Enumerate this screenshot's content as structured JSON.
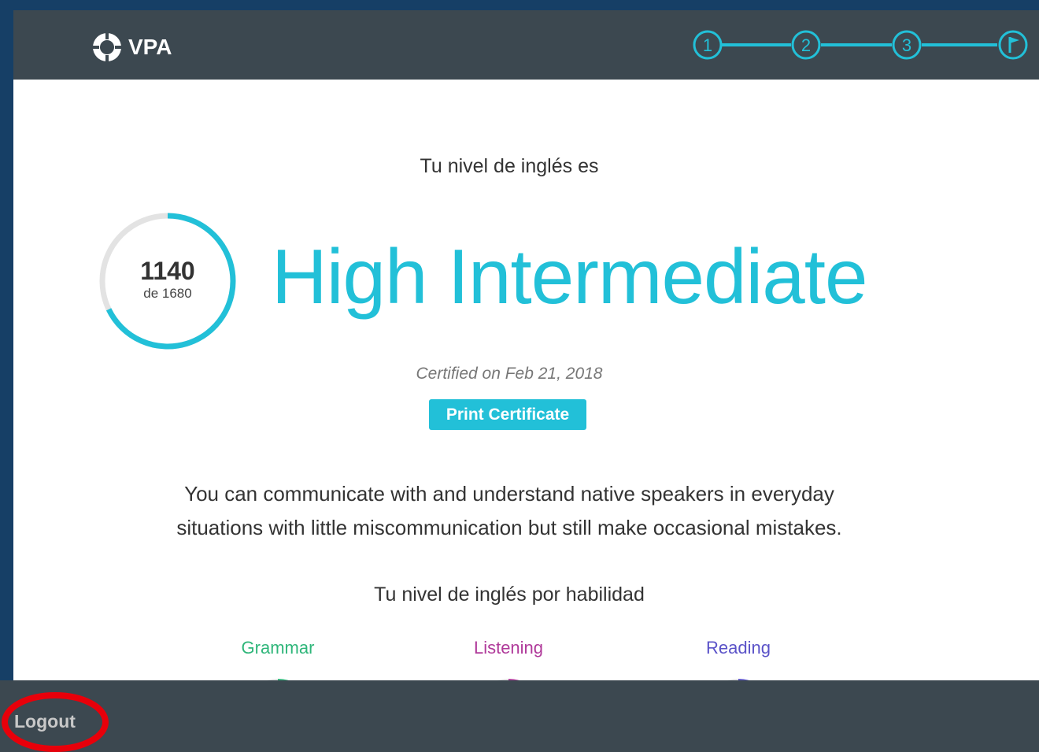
{
  "header": {
    "logo_text": "VPA",
    "logo_icon": "vpa-logo-icon",
    "steps": [
      "1",
      "2",
      "3"
    ],
    "final_step_icon": "finish-flag-icon",
    "accent": "#22c0d8"
  },
  "result": {
    "intro": "Tu nivel de inglés es",
    "score": "1140",
    "score_of": "de 1680",
    "score_fraction": 0.679,
    "level": "High Intermediate",
    "certified": "Certified on Feb 21, 2018",
    "print_label": "Print Certificate",
    "description_line1": "You can communicate with and understand native speakers in everyday",
    "description_line2": "situations with little miscommunication but still make occasional mistakes."
  },
  "skills": {
    "heading": "Tu nivel de inglés por habilidad",
    "items": [
      {
        "label": "Grammar",
        "color": "#2fb67a"
      },
      {
        "label": "Listening",
        "color": "#b03a9a"
      },
      {
        "label": "Reading",
        "color": "#5a52c8"
      }
    ]
  },
  "footer": {
    "logout_label": "Logout",
    "highlight_color": "#e8000a"
  }
}
